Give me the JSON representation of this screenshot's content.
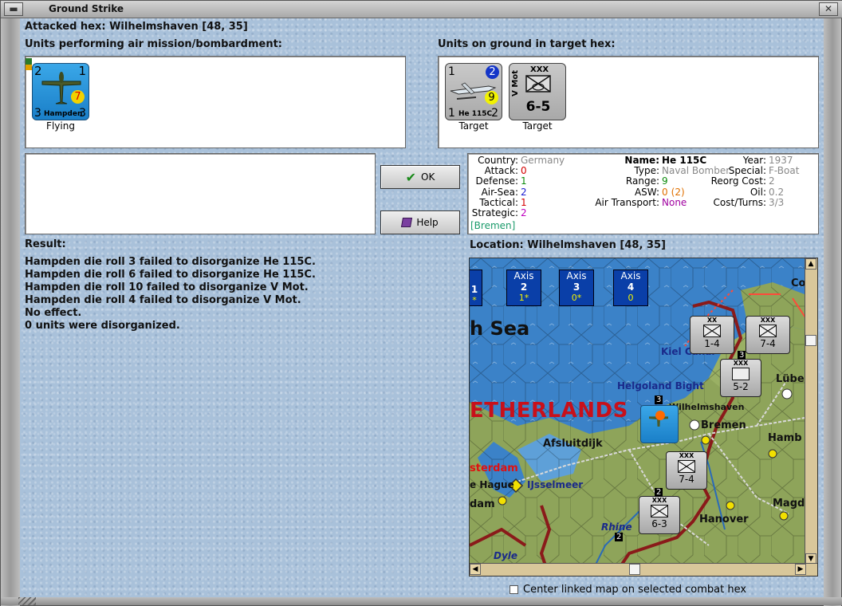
{
  "window": {
    "title": "Ground Strike"
  },
  "attacked_hex_label": "Attacked hex: Wilhelmshaven  [48, 35]",
  "air_units": {
    "header": "Units performing air mission/bombardment:",
    "units": [
      {
        "name": "Hampden",
        "top_left": "2",
        "top_right": "1",
        "bottom_left": "3",
        "bottom_right": "3",
        "badge": "7",
        "caption": "Flying"
      }
    ]
  },
  "ground_units": {
    "header": "Units on ground in target hex:",
    "units": [
      {
        "name": "He 115C",
        "top_left": "1",
        "badge_blue": "2",
        "badge_yellow": "9",
        "bottom_left": "1",
        "bottom_right": "2",
        "caption": "Target"
      },
      {
        "name": "V Mot",
        "size": "XXX",
        "strength": "6-5",
        "caption": "Target"
      }
    ]
  },
  "buttons": {
    "ok_label": "OK",
    "help_label": "Help"
  },
  "info": {
    "left": [
      {
        "key": "Country:",
        "value": "Germany",
        "color": "#888888"
      },
      {
        "key": "Attack:",
        "value": "0",
        "color": "#d40000"
      },
      {
        "key": "Defense:",
        "value": "1",
        "color": "#0a8a0a"
      },
      {
        "key": "Air-Sea:",
        "value": "2",
        "color": "#1a1ad0"
      },
      {
        "key": "Tactical:",
        "value": "1",
        "color": "#d40000"
      },
      {
        "key": "Strategic:",
        "value": "2",
        "color": "#c000c0"
      }
    ],
    "base": "[Bremen]",
    "middle": [
      {
        "key": "Name:",
        "value": "He 115C",
        "color": "#000000"
      },
      {
        "key": "Type:",
        "value": "Naval Bomber",
        "color": "#888888"
      },
      {
        "key": "Range:",
        "value": "9",
        "color": "#0a8a0a"
      },
      {
        "key": "ASW:",
        "value": "0",
        "extra": "(2)",
        "color": "#e07000"
      },
      {
        "key": "Air Transport:",
        "value": "None",
        "color": "#a000a0"
      }
    ],
    "right": [
      {
        "key": "Year:",
        "value": "1937",
        "color": "#888888"
      },
      {
        "key": "Special:",
        "value": "F-Boat",
        "color": "#888888"
      },
      {
        "key": "Reorg Cost:",
        "value": "2",
        "color": "#888888"
      },
      {
        "key": "Oil:",
        "value": "0.2",
        "color": "#888888"
      },
      {
        "key": "Cost/Turns:",
        "value": "3/3",
        "color": "#888888"
      }
    ]
  },
  "result": {
    "header": "Result:",
    "lines": [
      "Hampden die roll 3 failed to disorganize He 115C.",
      "Hampden die roll 6 failed to disorganize He 115C.",
      "Hampden die roll 10 failed to disorganize V Mot.",
      "Hampden die roll 4 failed to disorganize V Mot.",
      "No effect.",
      "0 units were disorganized."
    ]
  },
  "location_label": "Location:  Wilhelmshaven  [48, 35]",
  "map": {
    "boxes": [
      {
        "label": "Axis",
        "num": "2",
        "sub": "1*"
      },
      {
        "label": "Axis",
        "num": "3",
        "sub": "0*"
      },
      {
        "label": "Axis",
        "num": "4",
        "sub": "0"
      }
    ],
    "partial_box_num": "1",
    "partial_box_sub": "*",
    "places": [
      {
        "text": "h Sea",
        "style": "sea"
      },
      {
        "text": "ETHERLANDS",
        "style": "country"
      },
      {
        "text": "Kiel Canal",
        "style": "water"
      },
      {
        "text": "Helgoland Bight",
        "style": "water"
      },
      {
        "text": "Wilhelmshaven",
        "style": "city"
      },
      {
        "text": "Bremen",
        "style": "city"
      },
      {
        "text": "Hamb",
        "style": "city"
      },
      {
        "text": "Lübe",
        "style": "city"
      },
      {
        "text": "Afsluitdijk",
        "style": "city"
      },
      {
        "text": "sterdam",
        "style": "capital"
      },
      {
        "text": "e Hague",
        "style": "city"
      },
      {
        "text": "IJsselmeer",
        "style": "water"
      },
      {
        "text": "dam",
        "style": "city"
      },
      {
        "text": "Rhine",
        "style": "water"
      },
      {
        "text": "Hanover",
        "style": "city"
      },
      {
        "text": "Magd",
        "style": "city"
      },
      {
        "text": "Dyle",
        "style": "water"
      },
      {
        "text": "Co",
        "style": "city"
      }
    ],
    "counters": [
      {
        "strength": "1-4",
        "size": "XX"
      },
      {
        "strength": "7-4",
        "size": "XXX"
      },
      {
        "strength": "5-2",
        "size": "XXX"
      },
      {
        "strength": "7-4",
        "size": "XXX"
      },
      {
        "strength": "6-3",
        "size": "XXX"
      }
    ],
    "stack_labels": [
      "3",
      "3",
      "2",
      "2"
    ]
  },
  "center_checkbox": {
    "label": "Center linked map on selected combat hex",
    "checked": false
  }
}
